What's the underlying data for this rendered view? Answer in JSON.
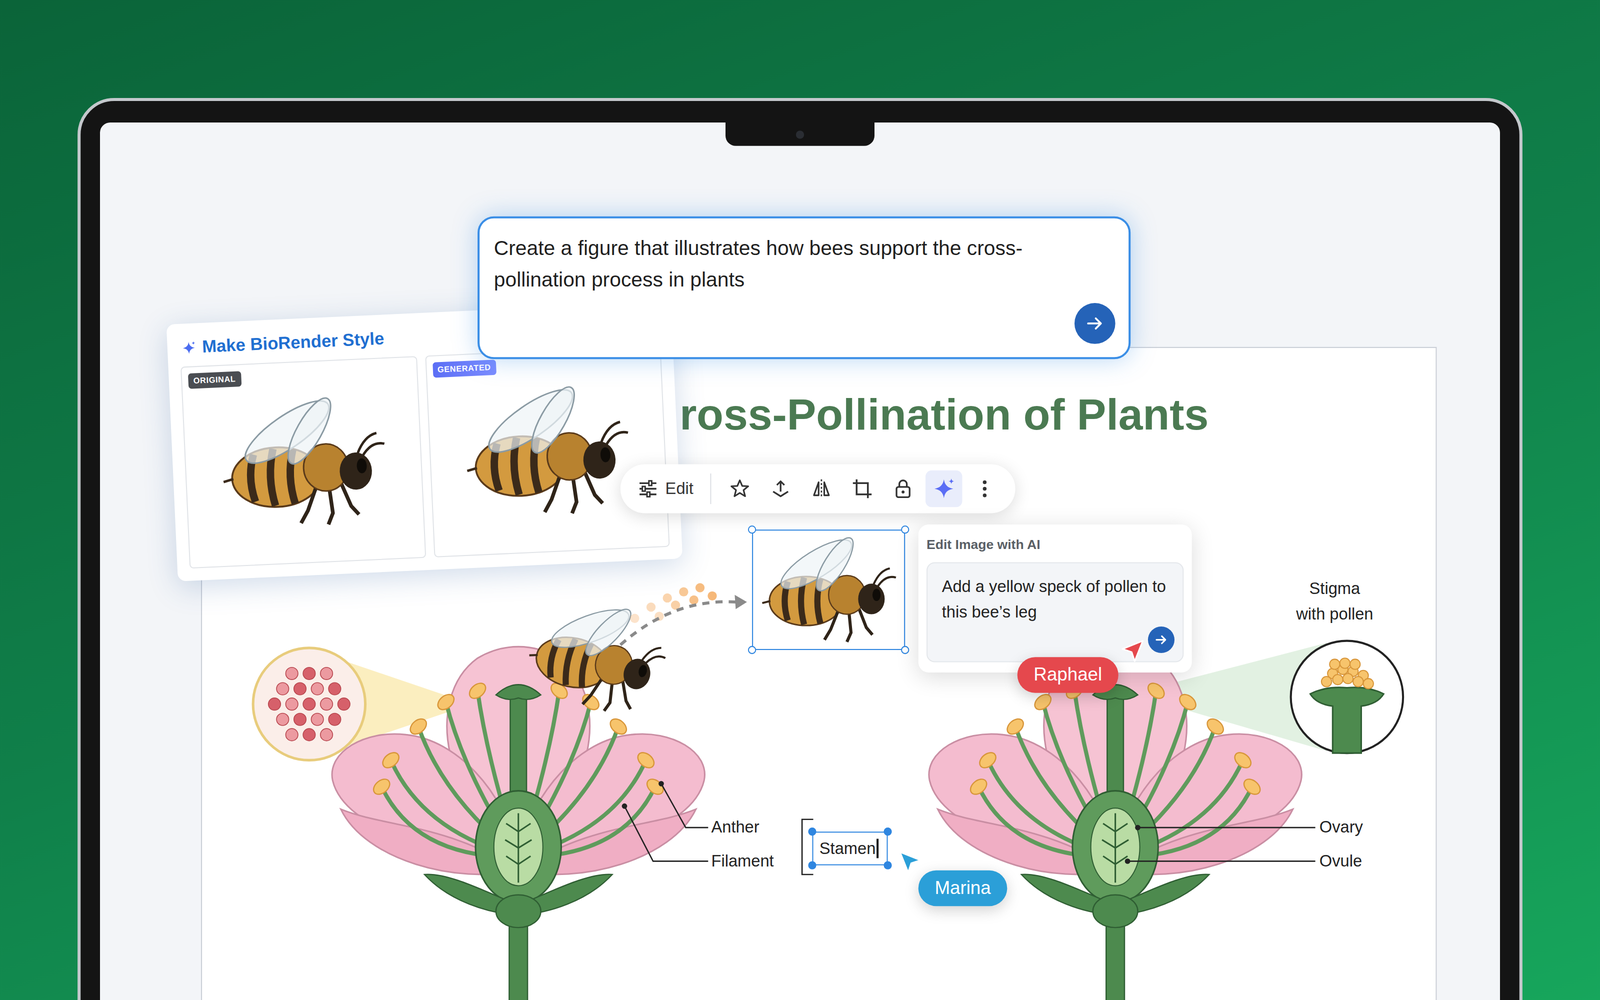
{
  "prompt": {
    "text": "Create a figure that illustrates how bees support the cross-pollination process in plants"
  },
  "style_card": {
    "title": "Make BioRender Style",
    "panels": [
      {
        "badge": "ORIGINAL",
        "kind": "photo"
      },
      {
        "badge": "GENERATED",
        "kind": "illustration"
      }
    ]
  },
  "figure": {
    "title": "ross-Pollination of Plants"
  },
  "toolbar": {
    "edit_label": "Edit",
    "tools": [
      {
        "kind": "star",
        "selected": false
      },
      {
        "kind": "upload",
        "selected": false
      },
      {
        "kind": "flip",
        "selected": false
      },
      {
        "kind": "crop",
        "selected": false
      },
      {
        "kind": "lock",
        "selected": false
      },
      {
        "kind": "ai",
        "selected": true
      },
      {
        "kind": "more",
        "selected": false
      }
    ]
  },
  "ai_edit": {
    "title": "Edit Image with AI",
    "text": "Add a yellow speck of pollen to this bee’s leg"
  },
  "labels": [
    {
      "text": "Anther"
    },
    {
      "text": "Filament"
    },
    {
      "text": "Ovary"
    },
    {
      "text": "Ovule"
    }
  ],
  "stigma_label": [
    "Stigma",
    "with pollen"
  ],
  "stamen_field": {
    "text": "Stamen",
    "editing": true
  },
  "collaborators": [
    {
      "name": "Raphael",
      "color": "#e5484d"
    },
    {
      "name": "Marina",
      "color": "#2b9fd8"
    }
  ]
}
